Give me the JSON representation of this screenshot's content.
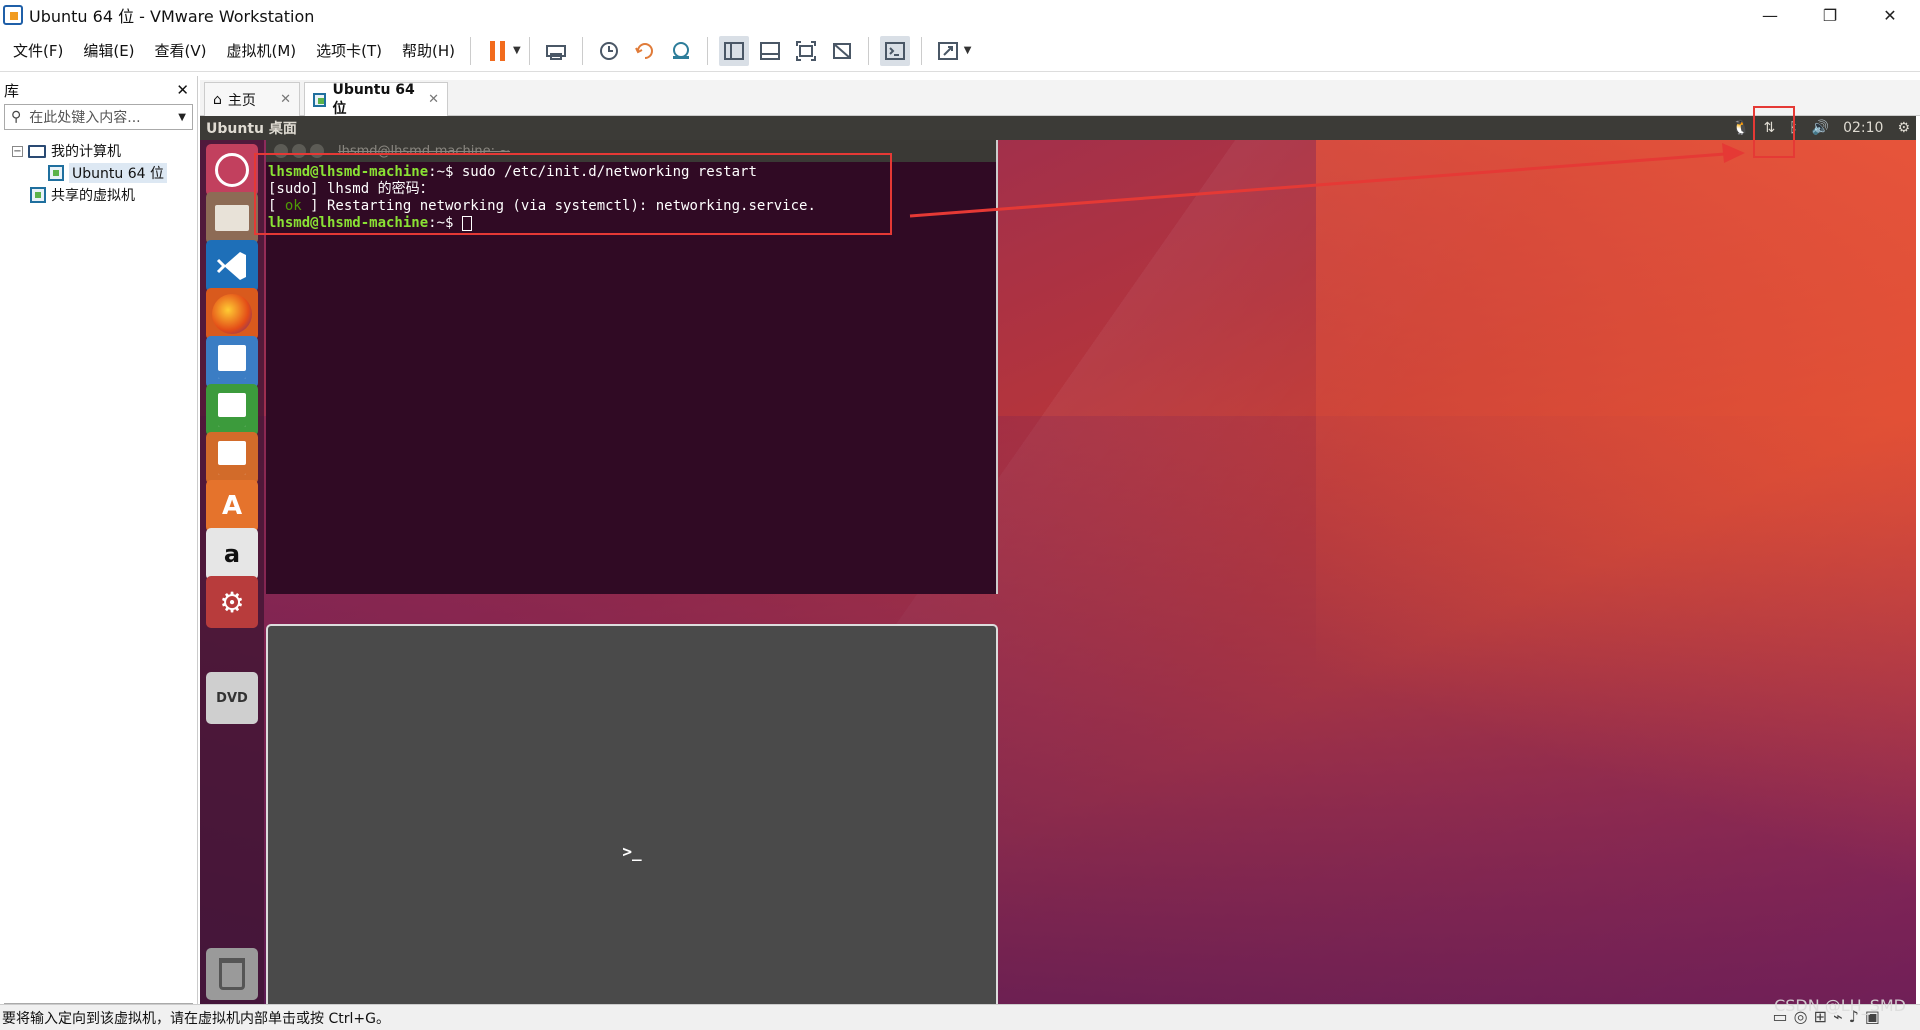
{
  "window": {
    "title": "Ubuntu 64 位 - VMware Workstation"
  },
  "window_controls": {
    "minimize": "—",
    "restore": "❐",
    "close": "✕"
  },
  "menu": [
    "文件(F)",
    "编辑(E)",
    "查看(V)",
    "虚拟机(M)",
    "选项卡(T)",
    "帮助(H)"
  ],
  "library": {
    "title": "库",
    "close": "✕",
    "search_placeholder": "在此处键入内容...",
    "tree": {
      "my_computer": "我的计算机",
      "vm": "Ubuntu 64 位",
      "shared": "共享的虚拟机"
    }
  },
  "tabs": [
    {
      "label": "主页",
      "close": "✕"
    },
    {
      "label": "Ubuntu 64 位",
      "close": "✕"
    }
  ],
  "ubuntu": {
    "panel_title": "Ubuntu 桌面",
    "clock": "02:10",
    "tray": {
      "network": "⇅",
      "bluetooth": "ᛒ",
      "volume": "🔊",
      "settings": "⚙"
    },
    "launcher": {
      "amazon": "a",
      "dvd": "DVD"
    }
  },
  "terminal": {
    "title": "lhsmd@lhsmd-machine: ~",
    "lines": {
      "l1_user": "lhsmd@lhsmd-machine",
      "l1_path": ":~",
      "l1_cmd": "$ sudo /etc/init.d/networking restart",
      "l2": "[sudo] lhsmd 的密码：",
      "l3_open": "[ ",
      "l3_ok": "ok",
      "l3_rest": " ] Restarting networking (via systemctl): networking.service.",
      "l4_user": "lhsmd@lhsmd-machine",
      "l4_path": ":~",
      "l4_cmd": "$ "
    }
  },
  "statusbar": {
    "text": "要将输入定向到该虚拟机，请在虚拟机内部单击或按 Ctrl+G。"
  },
  "watermark": "CSDN @LH_SMD",
  "colors": {
    "annotation": "#e53935",
    "terminal_bg": "#300a24",
    "prompt_user": "#8ae234"
  }
}
